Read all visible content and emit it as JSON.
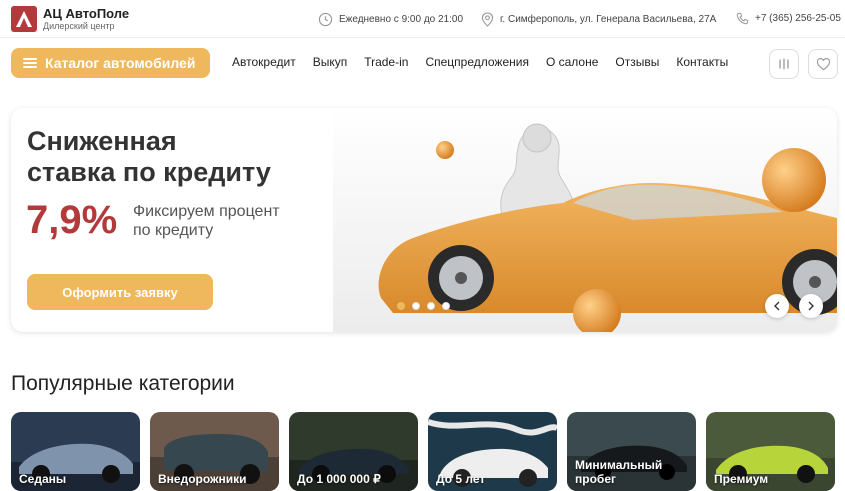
{
  "header": {
    "logo_title": "АЦ АвтоПоле",
    "logo_subtitle": "Дилерский центр",
    "hours": "Ежедневно с 9:00 до 21:00",
    "address": "г. Симферополь, ул. Генерала Васильева, 27А",
    "phone": "+7 (365) 256-25-05"
  },
  "nav": {
    "catalog_label": "Каталог автомобилей",
    "items": [
      "Автокредит",
      "Выкуп",
      "Trade-in",
      "Спецпредложения",
      "О салоне",
      "Отзывы",
      "Контакты"
    ]
  },
  "banner": {
    "headline_line1": "Сниженная",
    "headline_line2": "ставка по кредиту",
    "rate": "7,9%",
    "rate_text_line1": "Фиксируем процент",
    "rate_text_line2": "по кредиту",
    "cta": "Оформить заявку",
    "slides_total": 4,
    "active_slide": 1
  },
  "categories": {
    "title": "Популярные категории",
    "items": [
      {
        "label": "Седаны"
      },
      {
        "label": "Внедорожники"
      },
      {
        "label": "До 1 000 000 ₽"
      },
      {
        "label": "До 5 лет"
      },
      {
        "label": "Минимальный пробег"
      },
      {
        "label": "Премиум"
      }
    ]
  },
  "colors": {
    "accent": "#f0b85c",
    "brand_red": "#b23a3a"
  },
  "icons": {
    "clock": "clock-icon",
    "location": "location-pin-icon",
    "phone": "phone-icon",
    "compare": "compare-icon",
    "favorite": "heart-icon"
  }
}
